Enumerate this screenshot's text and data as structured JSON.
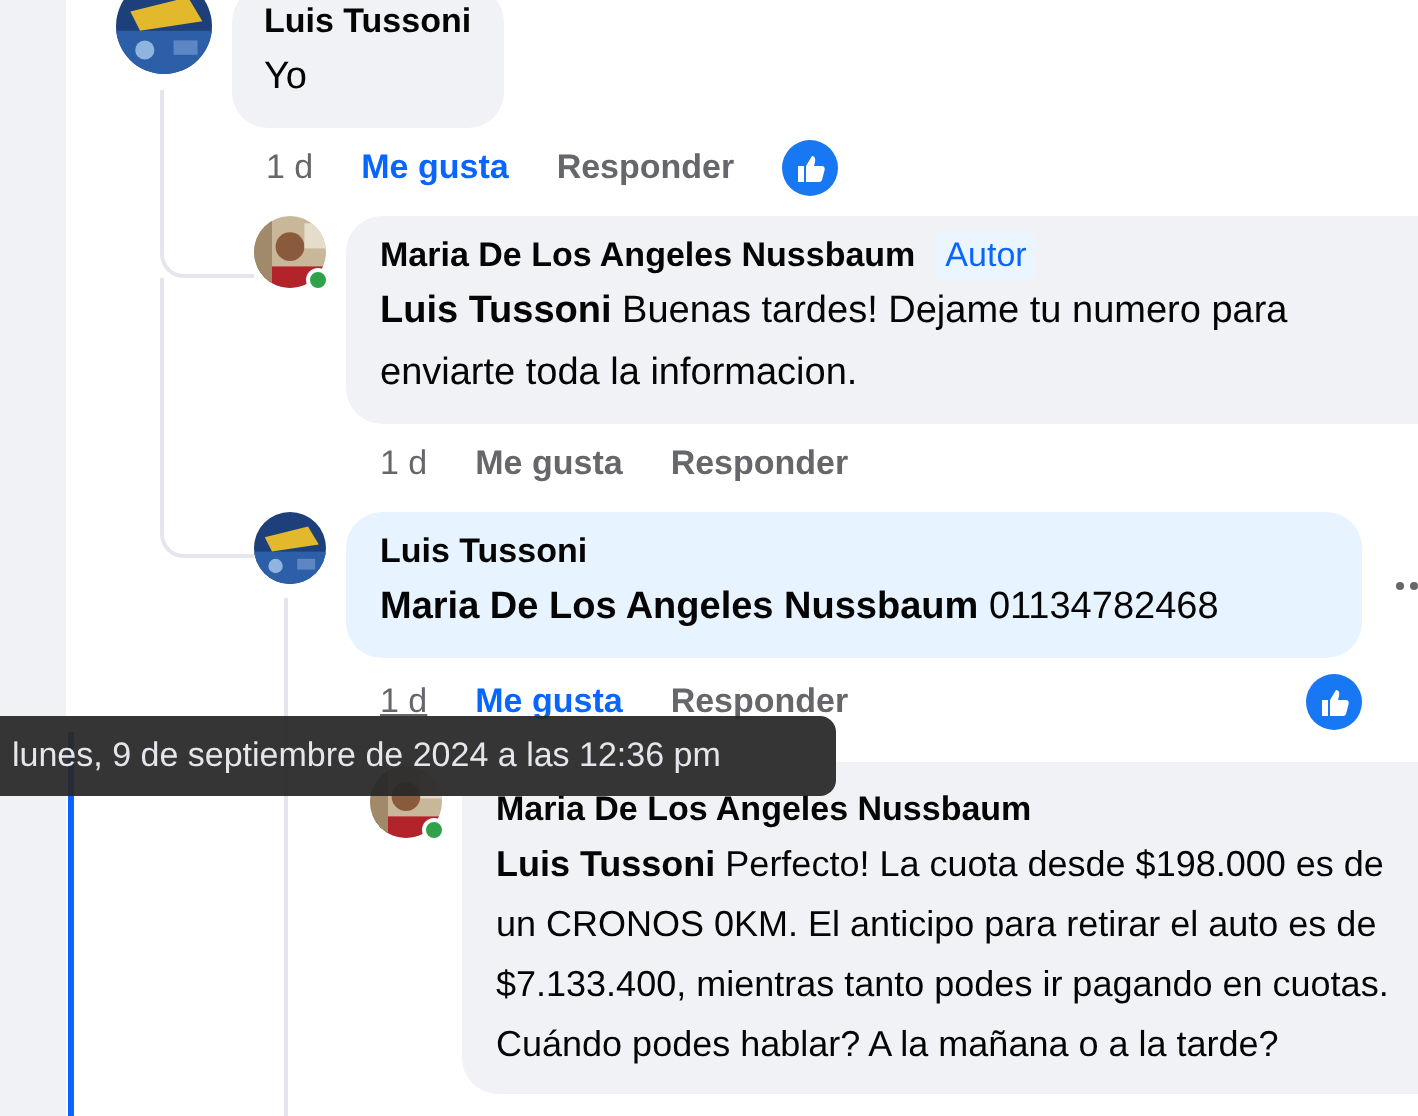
{
  "comments": [
    {
      "author": "Luis Tussoni",
      "text": "Yo",
      "avatar": {
        "kind": "picture"
      },
      "time": "1 d",
      "time_hovered": false,
      "like_label": "Me gusta",
      "liked": true,
      "reply_label": "Responder",
      "reaction": true,
      "children": [
        {
          "author": "Maria De Los Angeles Nussbaum",
          "badge": "Autor",
          "mention": "Luis Tussoni",
          "text": "Buenas tardes! Dejame tu numero para enviarte toda la informacion.",
          "avatar": {
            "kind": "picture",
            "online": true
          },
          "time": "1 d",
          "time_hovered": false,
          "like_label": "Me gusta",
          "liked": false,
          "reply_label": "Responder",
          "reaction": false
        },
        {
          "author": "Luis Tussoni",
          "mention": "Maria De Los Angeles Nussbaum",
          "text": "01134782468",
          "avatar": {
            "kind": "picture"
          },
          "highlighted": true,
          "more_menu": true,
          "time": "1 d",
          "time_hovered": true,
          "like_label": "Me gusta",
          "liked": true,
          "reply_label": "Responder",
          "reaction": true,
          "children": [
            {
              "author": "Maria De Los Angeles Nussbaum",
              "mention": "Luis Tussoni",
              "text": "Perfecto! La cuota desde $198.000 es de un CRONOS 0KM. El anticipo para retirar el auto es de $7.133.400, mientras tanto podes ir pagando en cuotas. Cuándo podes hablar? A la mañana o a la tarde?",
              "avatar": {
                "kind": "picture",
                "online": true
              }
            }
          ]
        }
      ]
    }
  ],
  "tooltip": {
    "text": "lunes, 9 de septiembre de 2024 a las 12:36 pm"
  }
}
